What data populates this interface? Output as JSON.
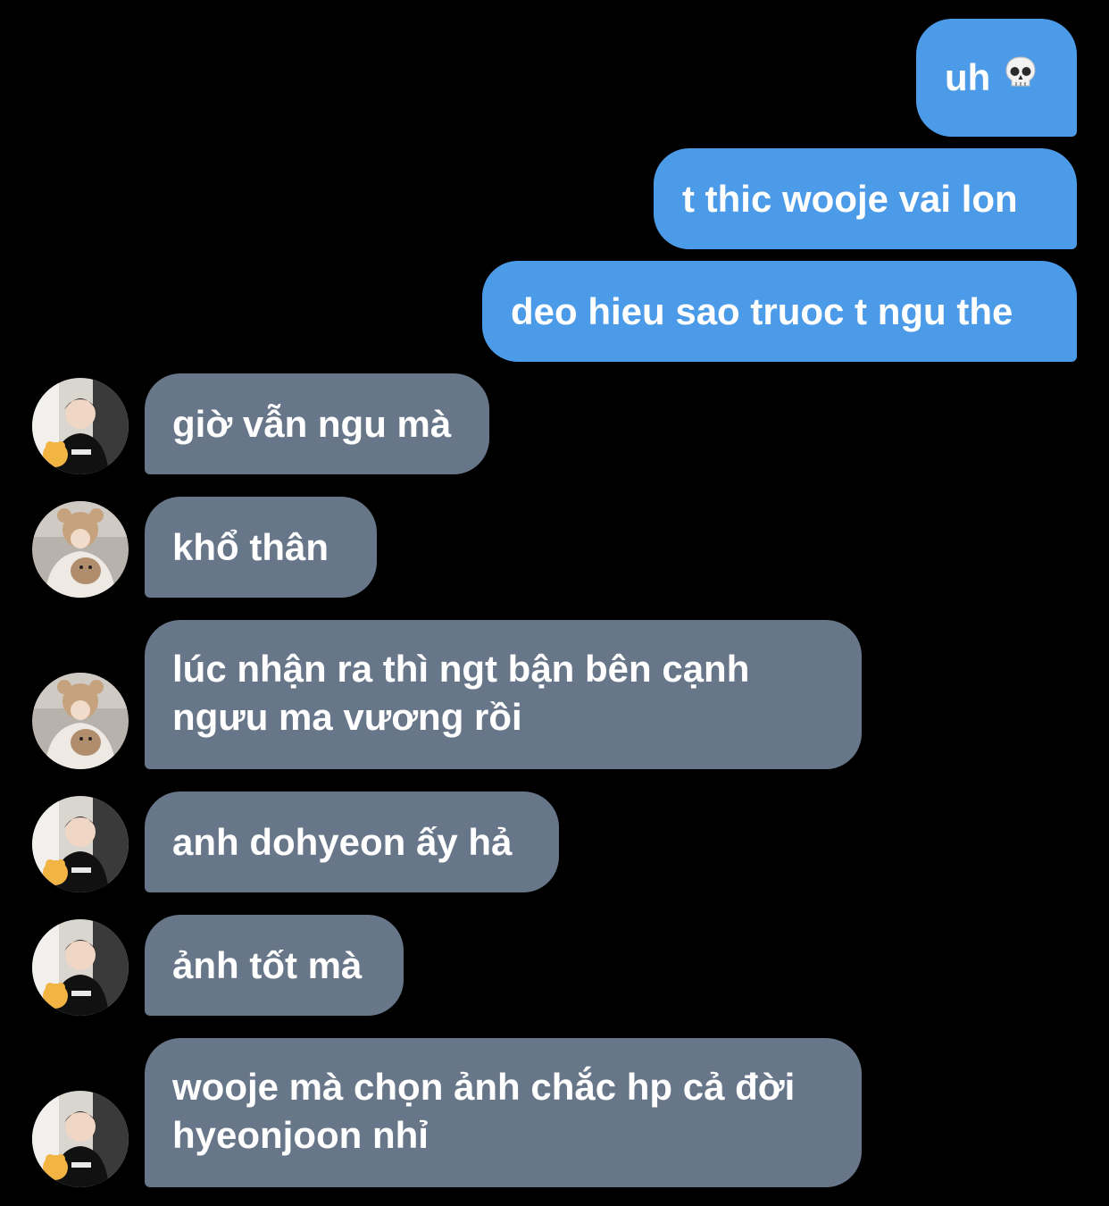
{
  "chat": {
    "colors": {
      "background": "#000000",
      "outgoing_bubble": "#4c9be8",
      "incoming_bubble": "#68768a",
      "text": "#ffffff"
    },
    "outgoing": [
      {
        "text": "uh",
        "icon": "skull-icon"
      },
      {
        "text": "t thic wooje vai lon"
      },
      {
        "text": "deo hieu sao truoc t ngu the"
      }
    ],
    "incoming": [
      {
        "text": "giờ vẫn ngu mà",
        "avatar": "avatar-boy-black-shirt"
      },
      {
        "text": "khổ thân",
        "avatar": "avatar-bear-hat"
      },
      {
        "lines": [
          "lúc nhận ra thì ngt bận bên cạnh",
          "ngưu ma vương rồi"
        ],
        "avatar": "avatar-bear-hat"
      },
      {
        "text": "anh dohyeon ấy hả",
        "avatar": "avatar-boy-black-shirt"
      },
      {
        "text": "ảnh tốt mà",
        "avatar": "avatar-boy-black-shirt"
      },
      {
        "lines": [
          "wooje mà chọn ảnh chắc hp cả đời",
          "hyeonjoon nhỉ"
        ],
        "avatar": "avatar-boy-black-shirt"
      }
    ]
  }
}
